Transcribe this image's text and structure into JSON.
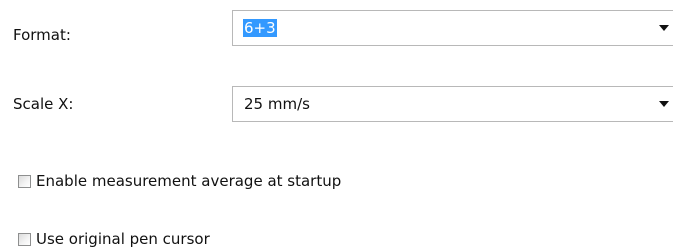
{
  "format": {
    "label": "Format:",
    "value": "6+3",
    "arrow_icon": "dropdown-arrow-icon"
  },
  "scale_x": {
    "label": "Scale X:",
    "value": "25 mm/s",
    "arrow_icon": "dropdown-arrow-icon"
  },
  "options": {
    "measurement_average": {
      "label": "Enable measurement average at startup",
      "checked": false
    },
    "pen_cursor": {
      "label": "Use original pen cursor",
      "checked": false
    }
  }
}
